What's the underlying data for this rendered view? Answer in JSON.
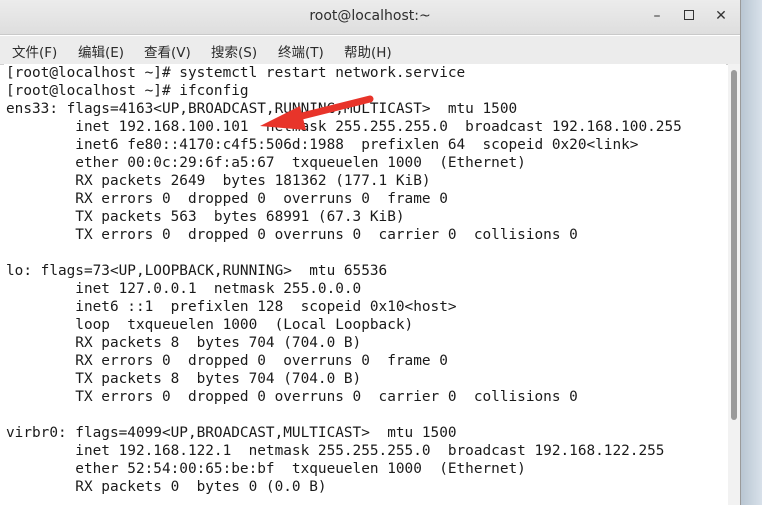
{
  "window": {
    "title": "root@localhost:~",
    "minimize_glyph": "–",
    "close_glyph": "✕"
  },
  "menu": [
    {
      "label": "文件(F)"
    },
    {
      "label": "编辑(E)"
    },
    {
      "label": "查看(V)"
    },
    {
      "label": "搜索(S)"
    },
    {
      "label": "终端(T)"
    },
    {
      "label": "帮助(H)"
    }
  ],
  "terminal": {
    "lines": [
      "[root@localhost ~]# systemctl restart network.service",
      "[root@localhost ~]# ifconfig",
      "ens33: flags=4163<UP,BROADCAST,RUNNING,MULTICAST>  mtu 1500",
      "        inet 192.168.100.101  netmask 255.255.255.0  broadcast 192.168.100.255",
      "        inet6 fe80::4170:c4f5:506d:1988  prefixlen 64  scopeid 0x20<link>",
      "        ether 00:0c:29:6f:a5:67  txqueuelen 1000  (Ethernet)",
      "        RX packets 2649  bytes 181362 (177.1 KiB)",
      "        RX errors 0  dropped 0  overruns 0  frame 0",
      "        TX packets 563  bytes 68991 (67.3 KiB)",
      "        TX errors 0  dropped 0 overruns 0  carrier 0  collisions 0",
      "",
      "lo: flags=73<UP,LOOPBACK,RUNNING>  mtu 65536",
      "        inet 127.0.0.1  netmask 255.0.0.0",
      "        inet6 ::1  prefixlen 128  scopeid 0x10<host>",
      "        loop  txqueuelen 1000  (Local Loopback)",
      "        RX packets 8  bytes 704 (704.0 B)",
      "        RX errors 0  dropped 0  overruns 0  frame 0",
      "        TX packets 8  bytes 704 (704.0 B)",
      "        TX errors 0  dropped 0 overruns 0  carrier 0  collisions 0",
      "",
      "virbr0: flags=4099<UP,BROADCAST,MULTICAST>  mtu 1500",
      "        inet 192.168.122.1  netmask 255.255.255.0  broadcast 192.168.122.255",
      "        ether 52:54:00:65:be:bf  txqueuelen 1000  (Ethernet)",
      "        RX packets 0  bytes 0 (0.0 B)"
    ]
  },
  "annotation": {
    "arrow_color": "#e8342a"
  }
}
